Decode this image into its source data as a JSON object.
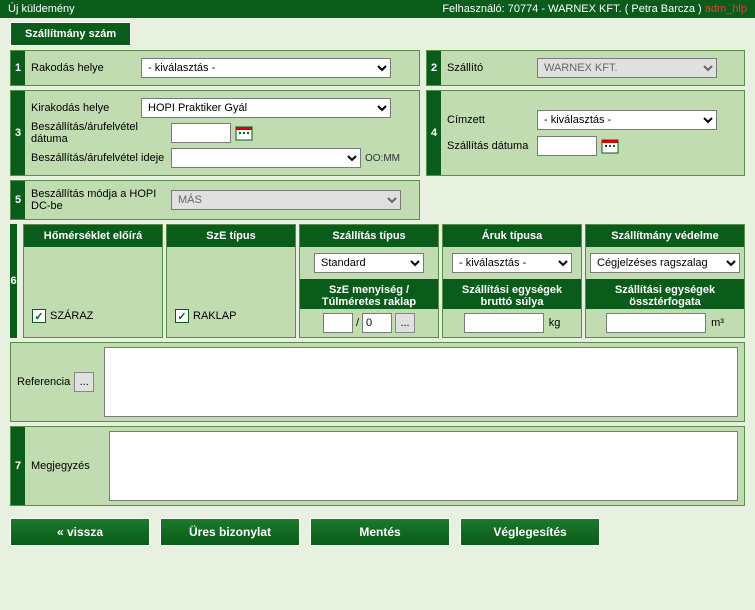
{
  "header": {
    "title": "Új küldemény",
    "user_label": "Felhasználó: 70774 - WARNEX KFT. ( Petra Barcza )",
    "user_suffix": "adm_hlp"
  },
  "toolbar": {
    "shipment_num": "Szállítmány szám"
  },
  "sections": {
    "s1": {
      "label": "Rakodás helye",
      "value": "- kiválasztás -"
    },
    "s2": {
      "label": "Szállító",
      "value": "WARNEX KFT."
    },
    "s3": {
      "unload_label": "Kirakodás helye",
      "unload_value": "HOPI Praktiker Gyál",
      "date_label": "Beszállítás/árufelvétel dátuma",
      "date_value": "",
      "time_label": "Beszállítás/árufelvétel ideje",
      "time_value": "",
      "time_hint": "OO:MM"
    },
    "s4": {
      "recipient_label": "Címzett",
      "recipient_value": "- kiválasztás -",
      "shipdate_label": "Szállítás dátuma",
      "shipdate_value": ""
    },
    "s5": {
      "label": "Beszállítás módja a HOPI DC-be",
      "value": "MÁS"
    }
  },
  "section6": {
    "cols": {
      "temp": {
        "head": "Hőmérséklet előírá",
        "checkbox_label": "SZÁRAZ",
        "checked": true
      },
      "sze_type": {
        "head": "SzE típus",
        "checkbox_label": "RAKLAP",
        "checked": true
      },
      "ship_type": {
        "head": "Szállítás típus",
        "dropdown": "Standard",
        "sub_head": "SzE menyiség / Túlméretes raklap",
        "val1": "",
        "val2": "0",
        "sep": "/"
      },
      "goods": {
        "head": "Áruk típusa",
        "dropdown": "- kiválasztás -",
        "sub_head": "Szállítási egységek bruttó súlya",
        "val": "",
        "unit": "kg"
      },
      "protection": {
        "head": "Szállítmány védelme",
        "dropdown": "Cégjelzéses ragszalag",
        "sub_head": "Szállítási egységek össztérfogata",
        "val": "",
        "unit": "m³"
      }
    }
  },
  "ref": {
    "label": "Referencia",
    "btn": "..."
  },
  "s7": {
    "label": "Megjegyzés"
  },
  "footer": {
    "back": "« vissza",
    "blank": "Üres bizonylat",
    "save": "Mentés",
    "finalize": "Véglegesítés"
  }
}
